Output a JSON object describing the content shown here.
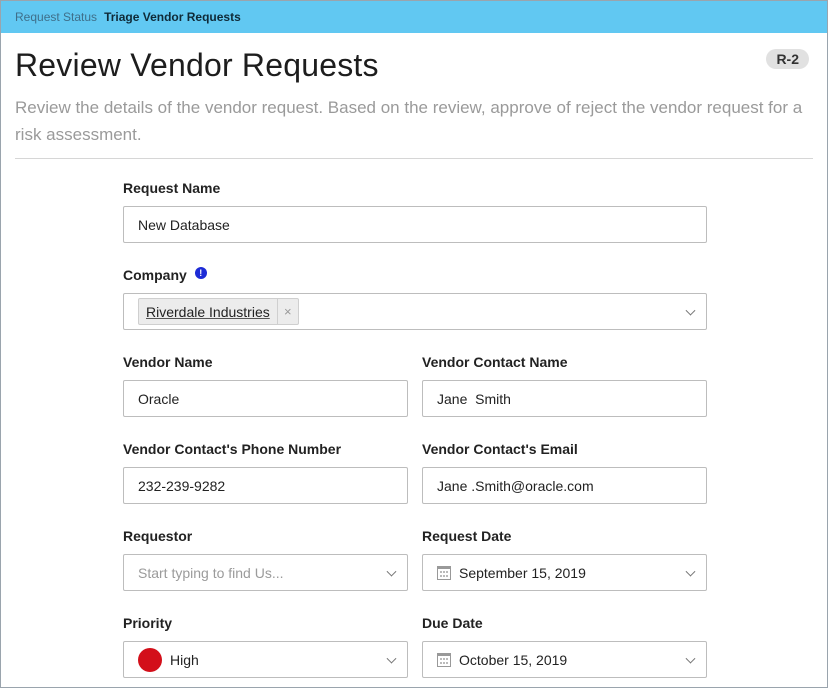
{
  "breadcrumb": {
    "parent": "Request Status",
    "current": "Triage Vendor Requests"
  },
  "page": {
    "title": "Review Vendor Requests",
    "badge": "R-2",
    "description": "Review the details of the vendor request. Based on the review, approve of reject the vendor request for a risk assessment."
  },
  "form": {
    "request_name": {
      "label": "Request Name",
      "value": "New Database"
    },
    "company": {
      "label": "Company",
      "tag": "Riverdale Industries",
      "remove": "×"
    },
    "vendor_name": {
      "label": "Vendor Name",
      "value": "Oracle"
    },
    "vendor_contact_name": {
      "label": "Vendor Contact Name",
      "value": "Jane  Smith"
    },
    "vendor_phone": {
      "label": "Vendor Contact's Phone Number",
      "value": "232-239-9282"
    },
    "vendor_email": {
      "label": "Vendor Contact's Email",
      "value": "Jane .Smith@oracle.com"
    },
    "requestor": {
      "label": "Requestor",
      "placeholder": "Start typing to find Us..."
    },
    "request_date": {
      "label": "Request Date",
      "value": "September 15, 2019"
    },
    "priority": {
      "label": "Priority",
      "value": "High",
      "color": "#d30f1a"
    },
    "due_date": {
      "label": "Due Date",
      "value": "October 15, 2019"
    }
  },
  "colors": {
    "topbar": "#61c8f2",
    "info_icon": "#1d2bd6"
  }
}
